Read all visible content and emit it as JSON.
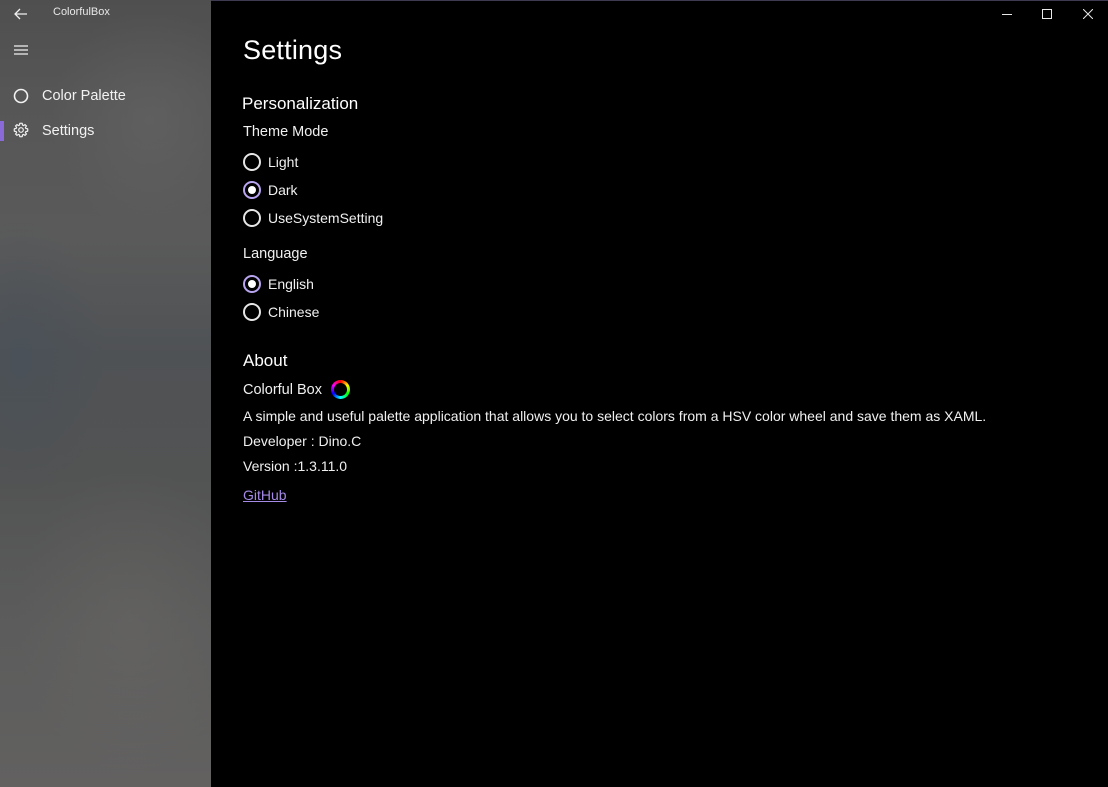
{
  "window": {
    "title": "ColorfulBox",
    "accent_color": "#8a6ad9"
  },
  "nav": {
    "items": [
      {
        "label": "Color Palette",
        "icon": "circle-icon",
        "selected": false
      },
      {
        "label": "Settings",
        "icon": "gear-icon",
        "selected": true
      }
    ]
  },
  "settings": {
    "title": "Settings",
    "personalization": {
      "title": "Personalization",
      "theme_mode": {
        "label": "Theme Mode",
        "options": [
          {
            "label": "Light",
            "checked": false
          },
          {
            "label": "Dark",
            "checked": true
          },
          {
            "label": "UseSystemSetting",
            "checked": false
          }
        ]
      },
      "language": {
        "label": "Language",
        "options": [
          {
            "label": "English",
            "checked": true
          },
          {
            "label": "Chinese",
            "checked": false
          }
        ]
      }
    },
    "about": {
      "title": "About",
      "app_name": "Colorful Box",
      "description": "A simple and useful palette application that allows you to select colors from a HSV color wheel and save them as XAML.",
      "developer": "Developer : Dino.C",
      "version": "Version :1.3.11.0",
      "link_label": "GitHub"
    }
  }
}
